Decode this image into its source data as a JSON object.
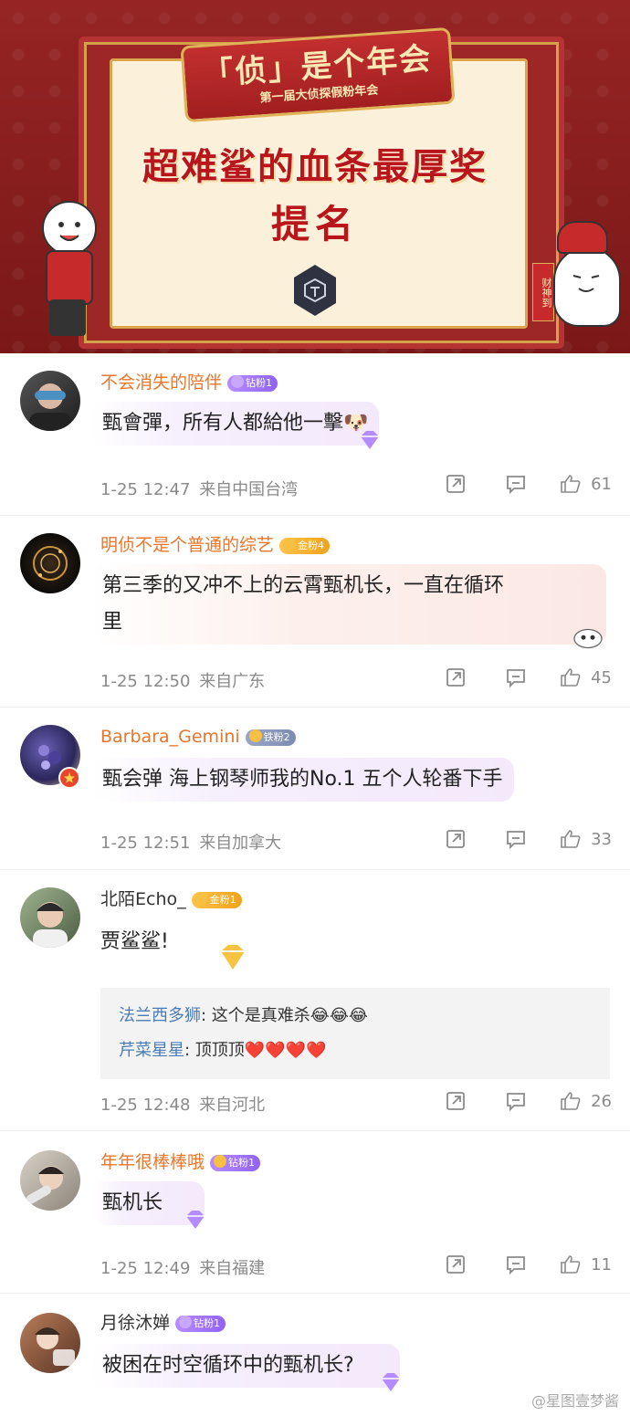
{
  "banner": {
    "scroll_title": "「侦」是个年会",
    "scroll_subtitle": "第一届大侦探假粉年会",
    "award": "超难鲨的血条最厚奖",
    "nominate": "提名",
    "fortune_tag": "财神到",
    "colors": {
      "bg": "#8c1f1f",
      "accent": "#b8161a",
      "gold": "#e0b257"
    }
  },
  "comments": [
    {
      "username": "不会消失的陪伴",
      "username_style": "vip",
      "badge": {
        "type": "diamond",
        "label": "钻粉1"
      },
      "text": "甄會彈，所有人都給他一擊🐶",
      "bubble": "purple",
      "time": "1-25 12:47",
      "location": "来自中国台湾",
      "likes": "61"
    },
    {
      "username": "明侦不是个普通的综艺",
      "username_style": "vip",
      "badge": {
        "type": "gold",
        "label": "金粉4"
      },
      "text_lines": [
        "第三季的又冲不上的云霄甄机长，一直在循环",
        "里"
      ],
      "bubble": "peach",
      "time": "1-25 12:50",
      "location": "来自广东",
      "likes": "45"
    },
    {
      "username": "Barbara_Gemini",
      "username_style": "vip",
      "badge": {
        "type": "iron",
        "label": "铁粉2"
      },
      "text": "甄会弹 海上钢琴师我的No.1  五个人轮番下手",
      "bubble": "purple",
      "time": "1-25 12:51",
      "location": "来自加拿大",
      "likes": "33"
    },
    {
      "username": "北陌Echo_",
      "username_style": "plain",
      "badge": {
        "type": "gold",
        "label": "金粉1"
      },
      "text": "贾鲨鲨!",
      "bubble": "none",
      "replies": [
        {
          "name": "法兰西多狮",
          "text": ": 这个是真难杀😂😂😂"
        },
        {
          "name": "芹菜星星",
          "text": ": 顶顶顶❤️❤️❤️❤️"
        }
      ],
      "time": "1-25 12:48",
      "location": "来自河北",
      "likes": "26"
    },
    {
      "username": "年年很棒棒哦",
      "username_style": "vip",
      "badge": {
        "type": "diamond",
        "label": "钻粉1"
      },
      "text": "甄机长",
      "bubble": "purple",
      "time": "1-25 12:49",
      "location": "来自福建",
      "likes": "11"
    },
    {
      "username": "月徐沐婵",
      "username_style": "plain",
      "badge": {
        "type": "diamond",
        "label": "钻粉1"
      },
      "text": "被困在时空循环中的甄机长?",
      "bubble": "purple"
    }
  ],
  "watermark": "@星图壹梦酱",
  "icons": {
    "share": "share-icon",
    "reply": "comment-icon",
    "like": "thumbs-up-icon"
  }
}
